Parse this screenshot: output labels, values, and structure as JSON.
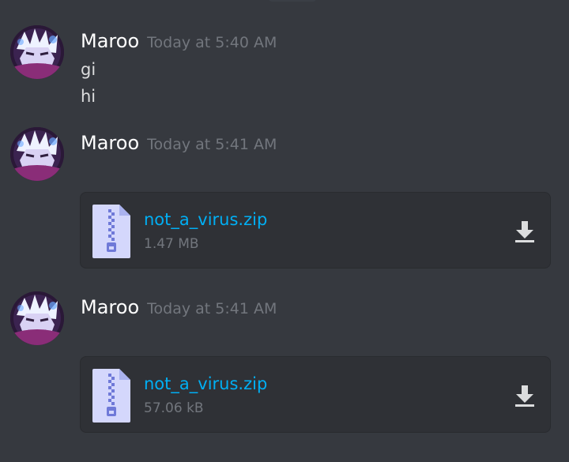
{
  "colors": {
    "background": "#36393f",
    "attachment_background": "#2f3136",
    "username": "#ffffff",
    "timestamp": "#72767d",
    "message_text": "#dcddde",
    "file_link": "#00aff4",
    "file_icon": "#d4d7fc",
    "download_icon": "#dcddde"
  },
  "messages": [
    {
      "author": "Maroo",
      "timestamp": "Today at 5:40 AM",
      "lines": [
        "gi",
        "hi"
      ],
      "avatar_icon": "user-avatar"
    },
    {
      "author": "Maroo",
      "timestamp": "Today at 5:41 AM",
      "attachment": {
        "filename": "not_a_virus.zip",
        "size": "1.47 MB",
        "file_icon": "zip-file-icon",
        "action_icon": "download-icon"
      },
      "avatar_icon": "user-avatar"
    },
    {
      "author": "Maroo",
      "timestamp": "Today at 5:41 AM",
      "attachment": {
        "filename": "not_a_virus.zip",
        "size": "57.06 kB",
        "file_icon": "zip-file-icon",
        "action_icon": "download-icon"
      },
      "avatar_icon": "user-avatar"
    }
  ]
}
